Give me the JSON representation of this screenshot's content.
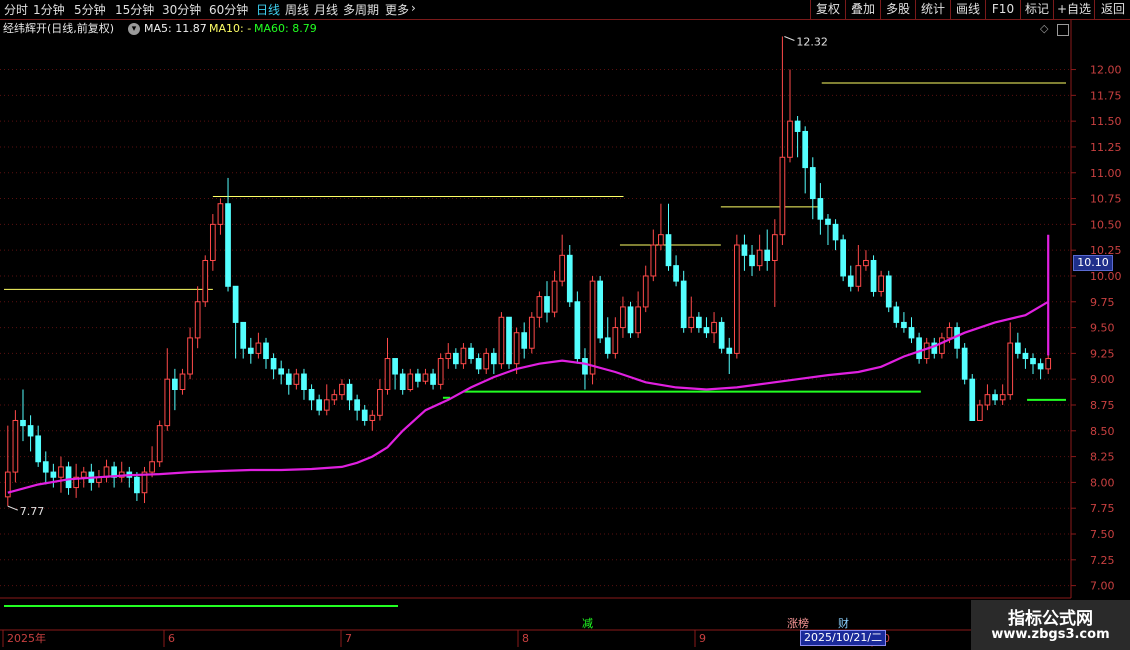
{
  "toolbar": {
    "periods": [
      "分时",
      "1分钟",
      "5分钟",
      "15分钟",
      "30分钟",
      "60分钟",
      "日线",
      "周线",
      "月线",
      "多周期",
      "更多"
    ],
    "active_period": "日线",
    "more_arrow": "›",
    "right_buttons": [
      "复权",
      "叠加",
      "多股",
      "统计",
      "画线",
      "F10",
      "标记",
      "+自选",
      "返回"
    ]
  },
  "info": {
    "stock_title": "经纬辉开(日线,前复权)",
    "ma5": "MA5: 11.87",
    "ma10": "MA10: -",
    "ma60": "MA60: 8.79"
  },
  "colors": {
    "up": "#ff4a4a",
    "down": "#54ffff",
    "ma": "#e020e0",
    "resistance": "#ffff66",
    "support": "#22ff22"
  },
  "chart_data": {
    "type": "candlestick",
    "y_axis_ticks": [
      "12.00",
      "11.75",
      "11.50",
      "11.25",
      "11.00",
      "10.75",
      "10.50",
      "10.25",
      "10.00",
      "9.75",
      "9.50",
      "9.25",
      "9.00",
      "8.75",
      "8.50",
      "8.25",
      "8.00",
      "7.75",
      "7.50",
      "7.25",
      "7.00"
    ],
    "ylim": [
      6.88,
      12.48
    ],
    "x_axis_labels": [
      "2025年",
      "6",
      "7",
      "8",
      "9",
      "10"
    ],
    "current_price": "10.10",
    "high_label": "12.32",
    "low_label": "7.77",
    "high_value": 12.32,
    "low_value": 7.77,
    "candles": [
      [
        7.86,
        8.1,
        8.55,
        7.77
      ],
      [
        8.1,
        8.6,
        8.7,
        8.0
      ],
      [
        8.6,
        8.55,
        8.9,
        8.4
      ],
      [
        8.55,
        8.45,
        8.65,
        8.3
      ],
      [
        8.45,
        8.2,
        8.55,
        8.15
      ],
      [
        8.2,
        8.1,
        8.3,
        7.98
      ],
      [
        8.1,
        8.05,
        8.18,
        7.95
      ],
      [
        8.05,
        8.15,
        8.25,
        7.9
      ],
      [
        8.15,
        7.95,
        8.2,
        7.88
      ],
      [
        7.95,
        8.05,
        8.18,
        7.85
      ],
      [
        8.05,
        8.1,
        8.15,
        7.95
      ],
      [
        8.1,
        8.0,
        8.18,
        7.92
      ],
      [
        8.0,
        8.05,
        8.12,
        7.95
      ],
      [
        8.05,
        8.15,
        8.22,
        8.0
      ],
      [
        8.15,
        8.05,
        8.2,
        7.95
      ],
      [
        8.05,
        8.1,
        8.2,
        8.0
      ],
      [
        8.1,
        8.05,
        8.15,
        7.95
      ],
      [
        8.05,
        7.9,
        8.1,
        7.82
      ],
      [
        7.9,
        8.1,
        8.15,
        7.8
      ],
      [
        8.1,
        8.2,
        8.35,
        8.05
      ],
      [
        8.2,
        8.55,
        8.6,
        8.15
      ],
      [
        8.55,
        9.0,
        9.3,
        8.5
      ],
      [
        9.0,
        8.9,
        9.1,
        8.7
      ],
      [
        8.9,
        9.05,
        9.1,
        8.85
      ],
      [
        9.05,
        9.4,
        9.5,
        9.0
      ],
      [
        9.4,
        9.75,
        9.9,
        9.3
      ],
      [
        9.75,
        10.15,
        10.2,
        9.7
      ],
      [
        10.15,
        10.5,
        10.6,
        10.05
      ],
      [
        10.5,
        10.7,
        10.75,
        10.4
      ],
      [
        10.7,
        9.9,
        10.95,
        9.85
      ],
      [
        9.9,
        9.55,
        9.75,
        9.2
      ],
      [
        9.55,
        9.3,
        9.45,
        9.2
      ],
      [
        9.3,
        9.25,
        9.4,
        9.15
      ],
      [
        9.25,
        9.35,
        9.45,
        9.2
      ],
      [
        9.35,
        9.2,
        9.4,
        9.1
      ],
      [
        9.2,
        9.1,
        9.25,
        9.0
      ],
      [
        9.1,
        9.05,
        9.18,
        8.95
      ],
      [
        9.05,
        8.95,
        9.1,
        8.85
      ],
      [
        8.95,
        9.05,
        9.1,
        8.9
      ],
      [
        9.05,
        8.9,
        9.1,
        8.8
      ],
      [
        8.9,
        8.8,
        8.95,
        8.7
      ],
      [
        8.8,
        8.7,
        8.85,
        8.65
      ],
      [
        8.7,
        8.8,
        8.95,
        8.65
      ],
      [
        8.8,
        8.85,
        8.9,
        8.75
      ],
      [
        8.85,
        8.95,
        9.0,
        8.8
      ],
      [
        8.95,
        8.8,
        9.0,
        8.7
      ],
      [
        8.8,
        8.7,
        8.85,
        8.6
      ],
      [
        8.7,
        8.6,
        8.75,
        8.55
      ],
      [
        8.6,
        8.65,
        8.7,
        8.5
      ],
      [
        8.65,
        8.9,
        9.0,
        8.6
      ],
      [
        8.9,
        9.2,
        9.4,
        8.85
      ],
      [
        9.2,
        9.05,
        9.2,
        8.9
      ],
      [
        9.05,
        8.9,
        9.1,
        8.85
      ],
      [
        8.9,
        9.05,
        9.1,
        8.88
      ],
      [
        9.05,
        8.98,
        9.1,
        8.92
      ],
      [
        8.98,
        9.05,
        9.1,
        8.95
      ],
      [
        9.05,
        8.95,
        9.1,
        8.9
      ],
      [
        8.95,
        9.2,
        9.25,
        8.9
      ],
      [
        9.2,
        9.25,
        9.35,
        9.1
      ],
      [
        9.25,
        9.15,
        9.3,
        9.1
      ],
      [
        9.15,
        9.3,
        9.35,
        9.1
      ],
      [
        9.3,
        9.2,
        9.35,
        9.15
      ],
      [
        9.2,
        9.1,
        9.25,
        9.05
      ],
      [
        9.1,
        9.25,
        9.3,
        9.05
      ],
      [
        9.25,
        9.15,
        9.3,
        9.05
      ],
      [
        9.15,
        9.6,
        9.65,
        9.1
      ],
      [
        9.6,
        9.15,
        9.6,
        9.1
      ],
      [
        9.15,
        9.45,
        9.5,
        9.05
      ],
      [
        9.45,
        9.3,
        9.55,
        9.2
      ],
      [
        9.3,
        9.6,
        9.65,
        9.25
      ],
      [
        9.6,
        9.8,
        9.85,
        9.5
      ],
      [
        9.8,
        9.65,
        9.95,
        9.55
      ],
      [
        9.65,
        9.95,
        10.05,
        9.6
      ],
      [
        9.95,
        10.2,
        10.4,
        9.9
      ],
      [
        10.2,
        9.75,
        10.3,
        9.7
      ],
      [
        9.75,
        9.2,
        9.85,
        9.15
      ],
      [
        9.2,
        9.05,
        9.3,
        8.9
      ],
      [
        9.05,
        9.95,
        10.0,
        8.95
      ],
      [
        9.95,
        9.4,
        10.0,
        9.35
      ],
      [
        9.4,
        9.25,
        9.6,
        9.2
      ],
      [
        9.25,
        9.5,
        9.6,
        9.2
      ],
      [
        9.5,
        9.7,
        9.8,
        9.4
      ],
      [
        9.7,
        9.45,
        9.75,
        9.4
      ],
      [
        9.45,
        9.7,
        9.85,
        9.4
      ],
      [
        9.7,
        10.0,
        10.1,
        9.65
      ],
      [
        10.0,
        10.3,
        10.45,
        9.95
      ],
      [
        10.3,
        10.4,
        10.7,
        10.25
      ],
      [
        10.4,
        10.1,
        10.7,
        10.05
      ],
      [
        10.1,
        9.95,
        10.2,
        9.9
      ],
      [
        9.95,
        9.5,
        10.05,
        9.45
      ],
      [
        9.5,
        9.6,
        9.8,
        9.45
      ],
      [
        9.6,
        9.5,
        9.65,
        9.45
      ],
      [
        9.5,
        9.45,
        9.6,
        9.4
      ],
      [
        9.45,
        9.55,
        9.65,
        9.35
      ],
      [
        9.55,
        9.3,
        9.6,
        9.25
      ],
      [
        9.3,
        9.25,
        9.4,
        9.05
      ],
      [
        9.25,
        10.3,
        10.4,
        9.2
      ],
      [
        10.3,
        10.2,
        10.4,
        10.05
      ],
      [
        10.2,
        10.1,
        10.3,
        10.0
      ],
      [
        10.1,
        10.25,
        10.4,
        10.05
      ],
      [
        10.25,
        10.15,
        10.45,
        10.05
      ],
      [
        10.15,
        10.4,
        10.55,
        9.7
      ],
      [
        10.4,
        11.15,
        12.32,
        10.3
      ],
      [
        11.15,
        11.5,
        12.0,
        11.1
      ],
      [
        11.5,
        11.4,
        11.55,
        11.15
      ],
      [
        11.4,
        11.05,
        11.45,
        10.8
      ],
      [
        11.05,
        10.75,
        11.15,
        10.55
      ],
      [
        10.75,
        10.55,
        10.9,
        10.4
      ],
      [
        10.55,
        10.5,
        10.6,
        10.3
      ],
      [
        10.5,
        10.35,
        10.55,
        10.25
      ],
      [
        10.35,
        10.0,
        10.4,
        9.95
      ],
      [
        10.0,
        9.9,
        10.1,
        9.85
      ],
      [
        9.9,
        10.1,
        10.3,
        9.85
      ],
      [
        10.1,
        10.15,
        10.25,
        10.05
      ],
      [
        10.15,
        9.85,
        10.2,
        9.8
      ],
      [
        9.85,
        10.0,
        10.05,
        9.8
      ],
      [
        10.0,
        9.7,
        10.05,
        9.65
      ],
      [
        9.7,
        9.55,
        9.75,
        9.5
      ],
      [
        9.55,
        9.5,
        9.65,
        9.45
      ],
      [
        9.5,
        9.4,
        9.6,
        9.35
      ],
      [
        9.4,
        9.2,
        9.45,
        9.15
      ],
      [
        9.2,
        9.35,
        9.4,
        9.15
      ],
      [
        9.35,
        9.25,
        9.4,
        9.2
      ],
      [
        9.25,
        9.4,
        9.45,
        9.2
      ],
      [
        9.4,
        9.5,
        9.55,
        9.35
      ],
      [
        9.5,
        9.3,
        9.55,
        9.2
      ],
      [
        9.3,
        9.0,
        9.35,
        8.95
      ],
      [
        9.0,
        8.6,
        9.05,
        8.6
      ],
      [
        8.6,
        8.75,
        8.8,
        8.6
      ],
      [
        8.75,
        8.85,
        8.95,
        8.7
      ],
      [
        8.85,
        8.8,
        8.9,
        8.75
      ],
      [
        8.8,
        8.85,
        8.95,
        8.75
      ],
      [
        8.85,
        9.35,
        9.55,
        8.8
      ],
      [
        9.35,
        9.25,
        9.45,
        9.2
      ],
      [
        9.25,
        9.2,
        9.3,
        9.1
      ],
      [
        9.2,
        9.15,
        9.25,
        9.05
      ],
      [
        9.15,
        9.1,
        9.2,
        9.0
      ],
      [
        9.1,
        9.2,
        9.25,
        9.05
      ]
    ],
    "ma60": [
      [
        7.9,
        0
      ],
      [
        7.98,
        4
      ],
      [
        8.03,
        8
      ],
      [
        8.05,
        12
      ],
      [
        8.07,
        16
      ],
      [
        8.08,
        20
      ],
      [
        8.1,
        24
      ],
      [
        8.11,
        28
      ],
      [
        8.12,
        32
      ],
      [
        8.12,
        36
      ],
      [
        8.13,
        40
      ],
      [
        8.15,
        44
      ],
      [
        8.19,
        46
      ],
      [
        8.25,
        48
      ],
      [
        8.34,
        50
      ],
      [
        8.5,
        52
      ],
      [
        8.7,
        55
      ],
      [
        8.8,
        58
      ],
      [
        8.92,
        61
      ],
      [
        9.02,
        64
      ],
      [
        9.1,
        67
      ],
      [
        9.15,
        70
      ],
      [
        9.18,
        73
      ],
      [
        9.15,
        76
      ],
      [
        9.07,
        80
      ],
      [
        8.97,
        84
      ],
      [
        8.92,
        88
      ],
      [
        8.9,
        92
      ],
      [
        8.92,
        96
      ],
      [
        8.96,
        100
      ],
      [
        9.0,
        104
      ],
      [
        9.04,
        108
      ],
      [
        9.07,
        112
      ],
      [
        9.12,
        115
      ],
      [
        9.22,
        118
      ],
      [
        9.32,
        122
      ],
      [
        9.45,
        126
      ],
      [
        9.55,
        130
      ],
      [
        9.62,
        134
      ],
      [
        9.75,
        137
      ],
      [
        9.87,
        140
      ],
      [
        9.92,
        142
      ],
      [
        9.88,
        143
      ],
      [
        9.92,
        147
      ],
      [
        9.95,
        152
      ],
      [
        10.05,
        155
      ],
      [
        10.2,
        158
      ],
      [
        10.35,
        161
      ],
      [
        10.4,
        164
      ],
      [
        10.37,
        168
      ],
      [
        10.35,
        172
      ],
      [
        10.35,
        176
      ],
      [
        10.33,
        180
      ],
      [
        10.2,
        183
      ],
      [
        10.0,
        186
      ],
      [
        9.82,
        189
      ],
      [
        9.62,
        192
      ],
      [
        9.42,
        196
      ],
      [
        9.33,
        199
      ],
      [
        9.23,
        204
      ]
    ],
    "resistance_lines": [
      [
        9.87,
        0,
        1.18
      ],
      [
        10.77,
        1.18,
        3.5
      ],
      [
        10.3,
        3.48,
        4.05
      ],
      [
        10.67,
        4.05,
        4.62
      ],
      [
        11.87,
        4.62,
        6.0
      ]
    ],
    "support_lines": [
      [
        8.88,
        2.6,
        5.18
      ],
      [
        8.8,
        5.78,
        6.0
      ],
      [
        8.82,
        2.48,
        2.52
      ]
    ]
  },
  "markers": {
    "jian": "减",
    "zhangbang": "涨榜",
    "cai": "财"
  },
  "date_label": "2025/10/21/二",
  "watermark": {
    "title": "指标公式网",
    "url": "www.zbgs3.com"
  }
}
